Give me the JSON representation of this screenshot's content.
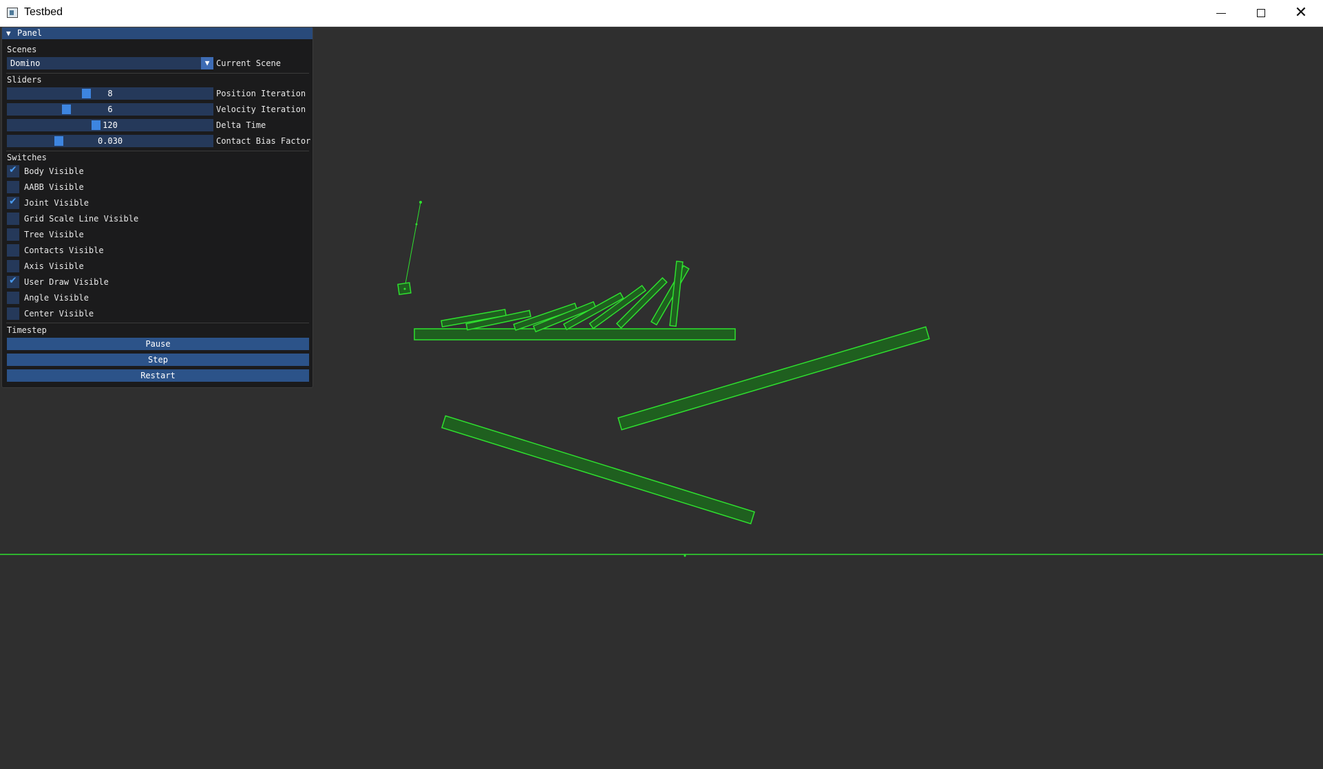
{
  "window": {
    "title": "Testbed"
  },
  "panel": {
    "title": "Panel",
    "scenes_label": "Scenes",
    "scene_select": {
      "value": "Domino",
      "label": "Current Scene"
    },
    "sliders_label": "Sliders",
    "sliders": [
      {
        "label": "Position Iteration",
        "value": "8",
        "fraction": 0.38
      },
      {
        "label": "Velocity Iteration",
        "value": "6",
        "fraction": 0.28
      },
      {
        "label": "Delta Time",
        "value": "120",
        "fraction": 0.43
      },
      {
        "label": "Contact Bias Factor",
        "value": "0.030",
        "fraction": 0.24
      }
    ],
    "switches_label": "Switches",
    "switches": [
      {
        "label": "Body Visible",
        "checked": true
      },
      {
        "label": "AABB Visible",
        "checked": false
      },
      {
        "label": "Joint Visible",
        "checked": true
      },
      {
        "label": "Grid Scale Line Visible",
        "checked": false
      },
      {
        "label": "Tree Visible",
        "checked": false
      },
      {
        "label": "Contacts Visible",
        "checked": false
      },
      {
        "label": "Axis Visible",
        "checked": false
      },
      {
        "label": "User Draw Visible",
        "checked": true
      },
      {
        "label": "Angle Visible",
        "checked": false
      },
      {
        "label": "Center Visible",
        "checked": false
      }
    ],
    "timestep_label": "Timestep",
    "buttons": {
      "pause": "Pause",
      "step": "Step",
      "restart": "Restart"
    }
  },
  "colors": {
    "background": "#2f2f2f",
    "body_stroke": "#2fe02f",
    "body_fill": "#1f5f1f",
    "panel_bg": "#1b1b1c",
    "accent": "#3d85e0"
  }
}
